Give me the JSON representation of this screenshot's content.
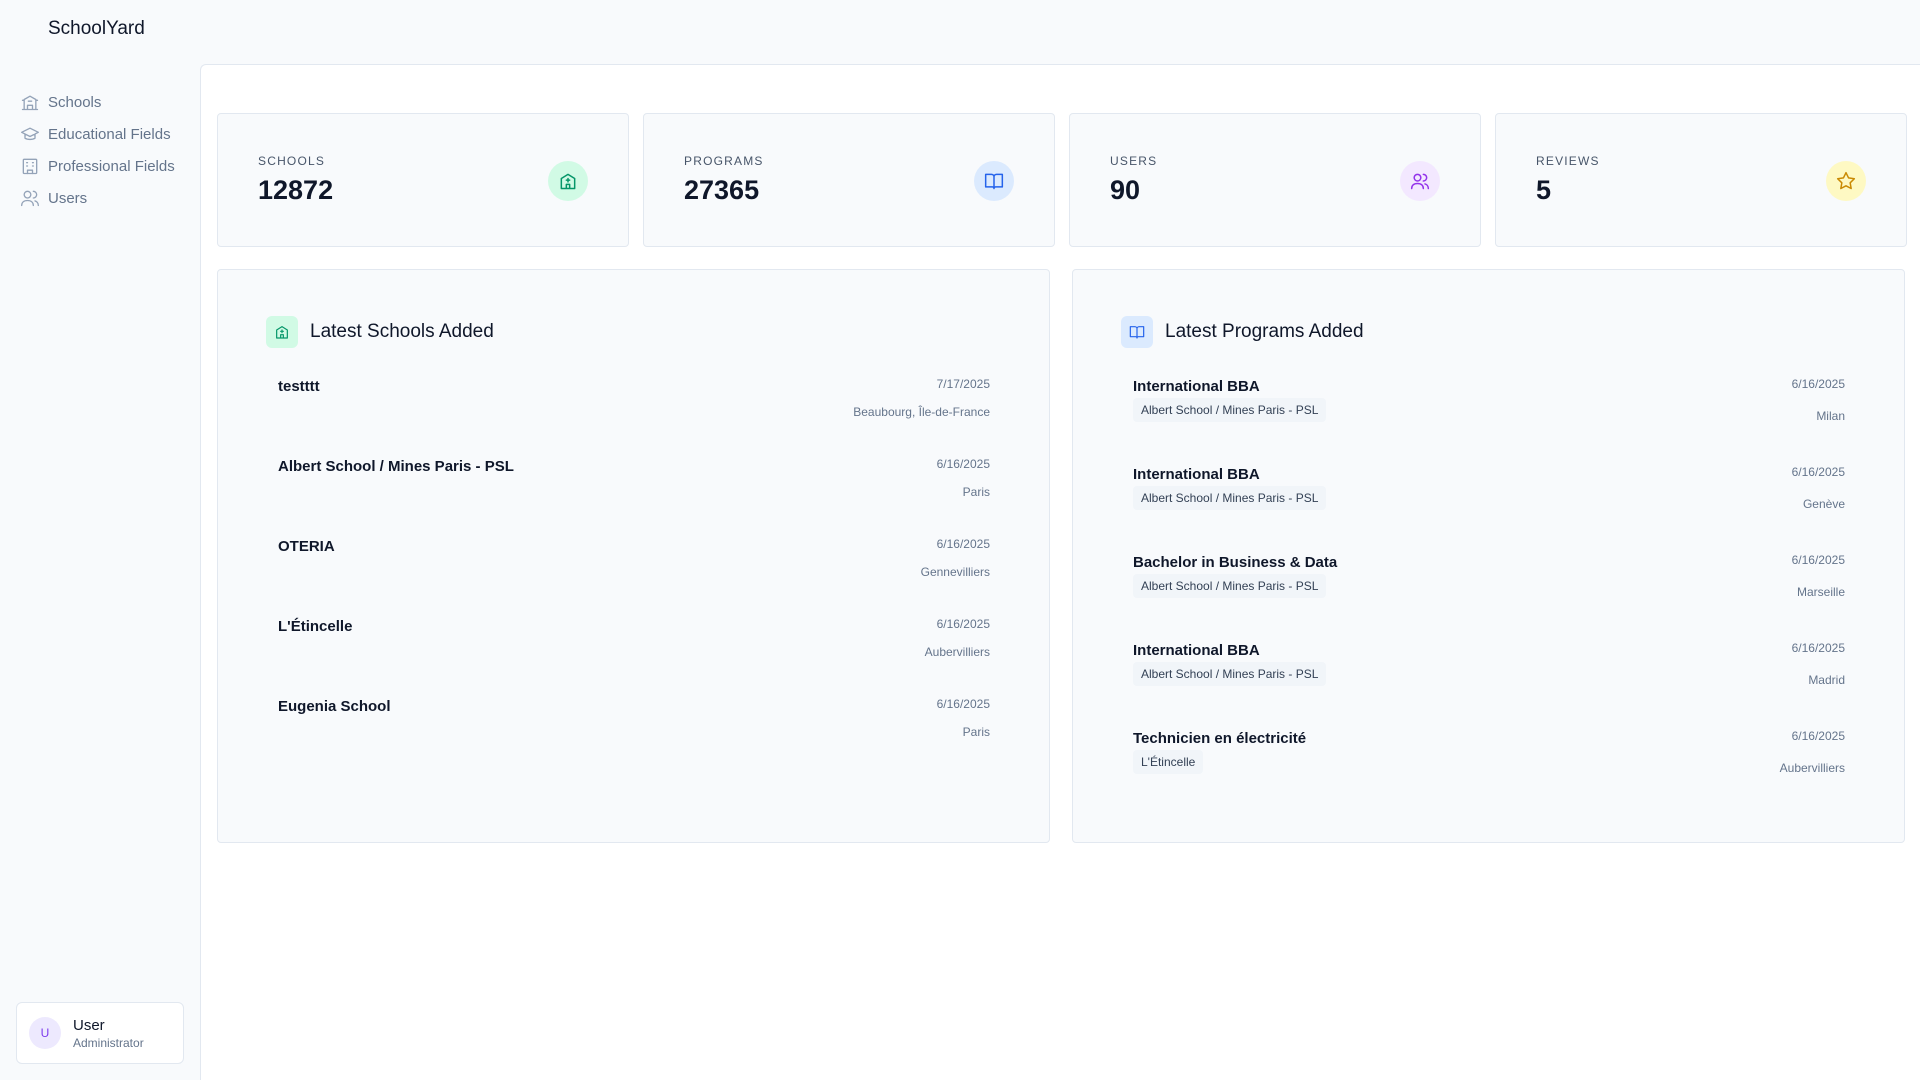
{
  "app": {
    "brand": "SchoolYard"
  },
  "sidebar": {
    "items": [
      {
        "label": "Schools",
        "icon": "school-icon"
      },
      {
        "label": "Educational Fields",
        "icon": "graduation-cap-icon"
      },
      {
        "label": "Professional Fields",
        "icon": "briefcase-icon"
      },
      {
        "label": "Users",
        "icon": "users-icon"
      }
    ]
  },
  "user": {
    "initial": "U",
    "name": "User",
    "role": "Administrator"
  },
  "stats": [
    {
      "label": "SCHOOLS",
      "value": "12872",
      "icon": "school-icon",
      "color": "#059669",
      "bg": "#d1fae5"
    },
    {
      "label": "PROGRAMS",
      "value": "27365",
      "icon": "book-open-icon",
      "color": "#2563eb",
      "bg": "#dbeafe"
    },
    {
      "label": "USERS",
      "value": "90",
      "icon": "users-icon",
      "color": "#9333ea",
      "bg": "#f3e8ff"
    },
    {
      "label": "REVIEWS",
      "value": "5",
      "icon": "star-icon",
      "color": "#ca8a04",
      "bg": "#fef9c3"
    }
  ],
  "latest_schools": {
    "title": "Latest Schools Added",
    "items": [
      {
        "name": "testttt",
        "date": "7/17/2025",
        "location": "Beaubourg, Île-de-France"
      },
      {
        "name": "Albert School / Mines Paris - PSL",
        "date": "6/16/2025",
        "location": "Paris"
      },
      {
        "name": "OTERIA",
        "date": "6/16/2025",
        "location": "Gennevilliers"
      },
      {
        "name": "L'Étincelle",
        "date": "6/16/2025",
        "location": "Aubervilliers"
      },
      {
        "name": "Eugenia School",
        "date": "6/16/2025",
        "location": "Paris"
      }
    ]
  },
  "latest_programs": {
    "title": "Latest Programs Added",
    "items": [
      {
        "name": "International BBA",
        "school": "Albert School / Mines Paris - PSL",
        "date": "6/16/2025",
        "location": "Milan"
      },
      {
        "name": "International BBA",
        "school": "Albert School / Mines Paris - PSL",
        "date": "6/16/2025",
        "location": "Genève"
      },
      {
        "name": "Bachelor in Business & Data",
        "school": "Albert School / Mines Paris - PSL",
        "date": "6/16/2025",
        "location": "Marseille"
      },
      {
        "name": "International BBA",
        "school": "Albert School / Mines Paris - PSL",
        "date": "6/16/2025",
        "location": "Madrid"
      },
      {
        "name": "Technicien en électricité",
        "school": "L'Étincelle",
        "date": "6/16/2025",
        "location": "Aubervilliers"
      }
    ]
  }
}
